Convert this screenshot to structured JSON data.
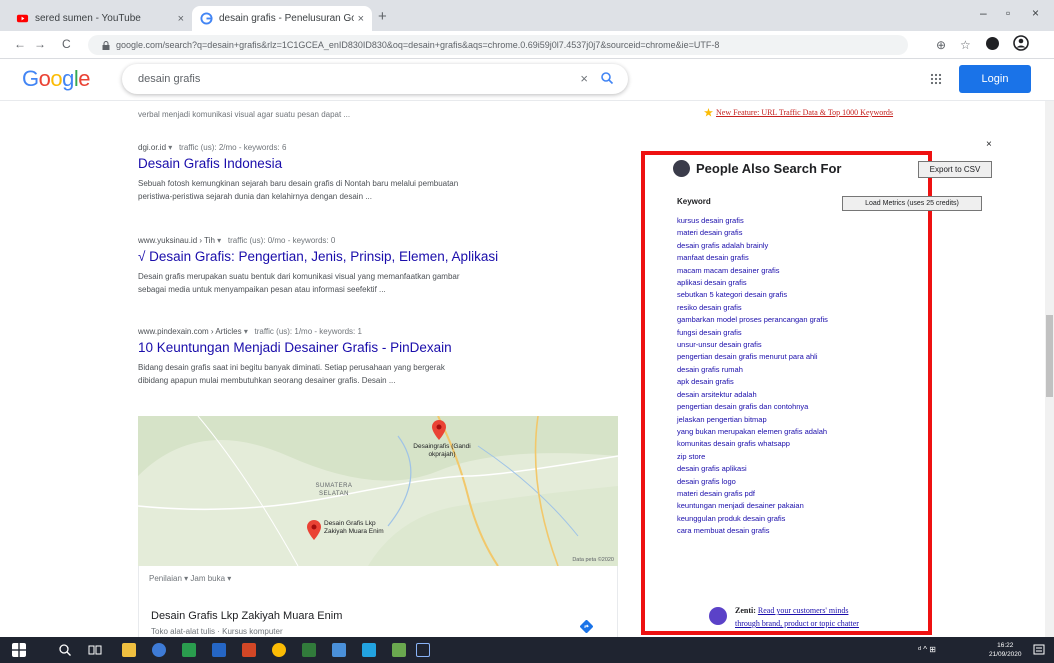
{
  "browser": {
    "tabs": [
      {
        "title": "sered sumen - YouTube",
        "favicon": "youtube-icon",
        "color": "#ff0000",
        "close": "×"
      },
      {
        "title": "desain grafis - Penelusuran Goo",
        "favicon": "google-icon",
        "color": "#4285f4",
        "close": "×"
      }
    ],
    "new_tab": "+",
    "window_controls": [
      "–",
      "▫",
      "×"
    ],
    "url": "google.com/search?q=desain+grafis&rlz=1C1GCEA_enID830ID830&oq=desain+grafis&aqs=chrome.0.69i59j0l7.4537j0j7&sourceid=chrome&ie=UTF-8",
    "nav": {
      "back": "←",
      "forward": "→",
      "reload": "C"
    },
    "toolbar_icons": [
      "⊕",
      "☆"
    ]
  },
  "google": {
    "logo_letters": [
      {
        "ch": "G",
        "color": "#4285f4"
      },
      {
        "ch": "o",
        "color": "#ea4335"
      },
      {
        "ch": "o",
        "color": "#fbbc05"
      },
      {
        "ch": "g",
        "color": "#4285f4"
      },
      {
        "ch": "l",
        "color": "#34a853"
      },
      {
        "ch": "e",
        "color": "#ea4335"
      }
    ],
    "query": "desain grafis",
    "clear": "×",
    "apps": "⋮⋮⋮",
    "login_label": "Login"
  },
  "results": {
    "top_snippet": "verbal menjadi komunikasi visual agar suatu pesan dapat ...",
    "items": [
      {
        "site": "dgi.or.id",
        "meta": "traffic (us): 2/mo - keywords: 6",
        "title": "Desain Grafis Indonesia",
        "snippet1": "Sebuah fotosh kemungkinan sejarah baru desain grafis di Nontah baru melalui pembuatan",
        "snippet2": "peristiwa-peristiwa sejarah dunia dan kelahirnya dengan desain ..."
      },
      {
        "site": "www.yuksinau.id › Tih",
        "meta": "traffic (us): 0/mo - keywords: 0",
        "title": "√ Desain Grafis: Pengertian, Jenis, Prinsip, Elemen, Aplikasi",
        "snippet1": "Desain grafis merupakan suatu bentuk dari komunikasi visual yang memanfaatkan gambar",
        "snippet2": "sebagai media untuk menyampaikan pesan atau informasi seefektif ..."
      },
      {
        "site": "www.pindexain.com › Articles",
        "meta": "traffic (us): 1/mo - keywords: 1",
        "title": "10 Keuntungan Menjadi Desainer Grafis - PinDexain",
        "snippet1": "Bidang desain grafis saat ini begitu banyak diminati. Setiap perusahaan yang bergerak",
        "snippet2": "dibidang apapun mulai membutuhkan seorang desainer grafis. Desain ..."
      }
    ]
  },
  "map": {
    "pin1_label": "Desaingrafis (Gandi okprajah)",
    "region_label": "SUMATERA SELATAN",
    "pin2_label": "Desain Grafis Lkp Zakiyah Muara Enim",
    "credit": "Data peta ©2020",
    "filters": "Penilaian ▾    Jam buka ▾",
    "place_name": "Desain Grafis Lkp Zakiyah Muara Enim",
    "place_sub": "Toko alat-alat tulis · Kursus komputer"
  },
  "extension": {
    "promo": "New Feature: URL Traffic Data & Top 1000 Keywords",
    "close": "×",
    "title": "People Also Search For",
    "export_label": "Export to CSV",
    "keyword_header": "Keyword",
    "metrics_label": "Load Metrics (uses 25 credits)",
    "keywords": [
      "kursus desain grafis",
      "materi desain grafis",
      "desain grafis adalah brainly",
      "manfaat desain grafis",
      "macam macam desainer grafis",
      "aplikasi desain grafis",
      "sebutkan 5 kategori desain grafis",
      "resiko desain grafis",
      "gambarkan model proses perancangan grafis",
      "fungsi desain grafis",
      "unsur-unsur desain grafis",
      "pengertian desain grafis menurut para ahli",
      "desain grafis rumah",
      "apk desain grafis",
      "desain arsitektur adalah",
      "pengertian desain grafis dan contohnya",
      "jelaskan pengertian bitmap",
      "yang bukan merupakan elemen grafis adalah",
      "komunitas desain grafis whatsapp",
      "zip store",
      "desain grafis aplikasi",
      "desain grafis logo",
      "materi desain grafis pdf",
      "keuntungan menjadi desainer pakaian",
      "keunggulan produk desain grafis",
      "cara membuat desain grafis"
    ],
    "footer_brand": "Zenti:",
    "footer_link1": "Read your customers' minds",
    "footer_link2": "through brand, product or topic chatter"
  },
  "taskbar": {
    "tray": "ᵈ ^ ⊞",
    "time": "16:22",
    "date": "21/09/2020"
  }
}
